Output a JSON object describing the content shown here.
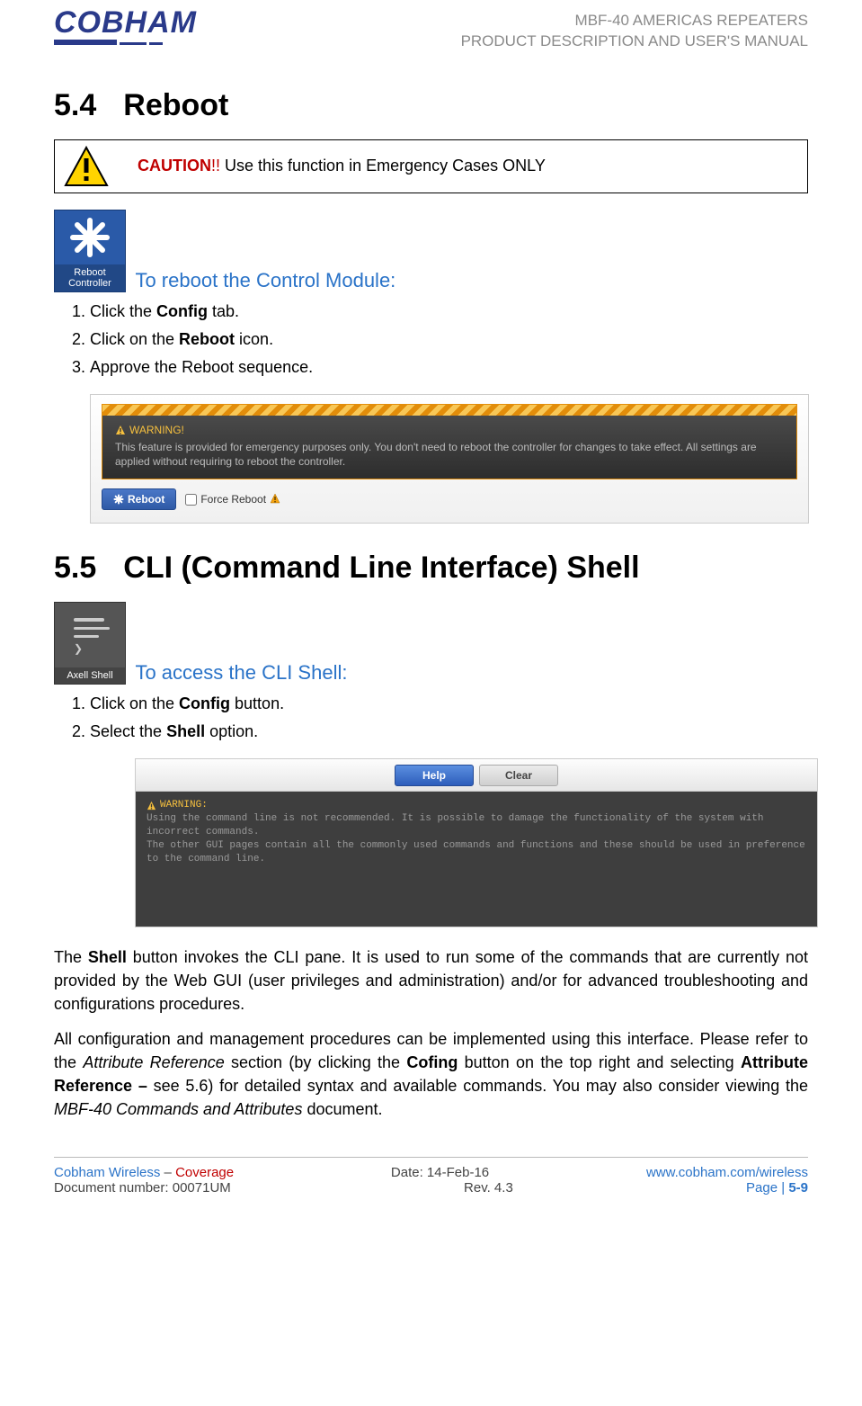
{
  "header": {
    "logo_text": "COBHAM",
    "doc_title_1": "MBF-40 AMERICAS REPEATERS",
    "doc_title_2": "PRODUCT DESCRIPTION AND USER'S MANUAL"
  },
  "s54": {
    "num": "5.4",
    "title": "Reboot",
    "caution_label": "CAUTION",
    "caution_bangs": "!!",
    "caution_text": "  Use this function in Emergency Cases ONLY",
    "icon_caption": "Reboot Controller",
    "lead": "To reboot the Control Module:",
    "steps": [
      {
        "pre": "Click the ",
        "bold": "Config",
        "post": " tab."
      },
      {
        "pre": "Click on the ",
        "bold": "Reboot",
        "post": " icon."
      },
      {
        "pre": "Approve the Reboot sequence.",
        "bold": "",
        "post": ""
      }
    ],
    "shot": {
      "warn_head": "WARNING!",
      "warn_body": "This feature is provided for emergency purposes only. You don't need to reboot the controller for changes to take effect. All settings are applied without requiring to reboot the controller.",
      "reboot_btn": "Reboot",
      "force_label": "Force Reboot"
    }
  },
  "s55": {
    "num": "5.5",
    "title": "CLI (Command Line Interface) Shell",
    "icon_caption": "Axell Shell",
    "lead": "To access the CLI Shell:",
    "steps": [
      {
        "pre": "Click on the ",
        "bold": "Config",
        "post": " button."
      },
      {
        "pre": "Select the ",
        "bold": "Shell",
        "post": " option."
      }
    ],
    "shot": {
      "help": "Help",
      "clear": "Clear",
      "warn_head": "WARNING:",
      "line1": "Using the command line is not recommended. It is possible to damage the functionality of the system with incorrect commands.",
      "line2": "The other GUI pages contain all the commonly used commands and functions and these should be used in preference to the command line."
    },
    "para1_a": "The ",
    "para1_b": "Shell",
    "para1_c": " button invokes the CLI pane. It is used to run some of the commands that are currently not provided by the Web GUI (user privileges and administration) and/or for advanced troubleshooting and configurations procedures.",
    "para2_a": "All configuration and management procedures can be implemented using this interface. Please refer to the ",
    "para2_b": "Attribute Reference",
    "para2_c": " section (by clicking the ",
    "para2_d": "Cofing",
    "para2_e": " button on the top right and selecting ",
    "para2_f": "Attribute Reference – ",
    "para2_g": "see 5.6) for detailed syntax and available commands. You may also consider viewing the ",
    "para2_h": "MBF-40 Commands and Attributes",
    "para2_i": " document."
  },
  "footer": {
    "left1a": "Cobham Wireless",
    "left1b": " – ",
    "left1c": "Coverage",
    "center1": "Date: 14-Feb-16",
    "right1": "www.cobham.com/wireless",
    "left2": "Document number: 00071UM",
    "center2": "Rev. 4.3",
    "right2a": "Page | ",
    "right2b": "5-9"
  }
}
